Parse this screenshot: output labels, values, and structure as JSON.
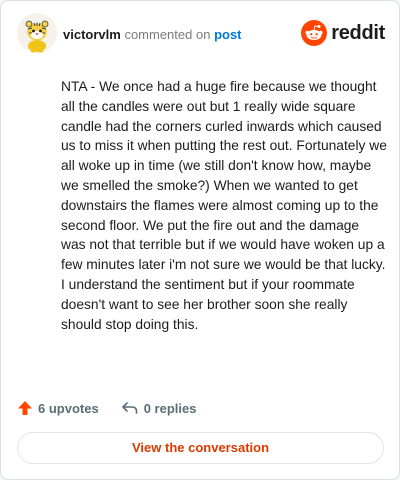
{
  "comment": {
    "author": "victorvlm",
    "action_text": "commented on",
    "post_link_label": "post",
    "body": "NTA - We once had a huge fire because we thought all the candles were out but 1 really wide square candle had the corners curled inwards which caused us to miss it when putting the rest out. Fortunately we all woke up in time (we still don't know how, maybe we smelled the smoke?) When we wanted to get downstairs the flames were almost coming up to the second floor. We put the fire out and the damage was not that terrible but if we would have woken up a few minutes later i'm not sure we would be that lucky. I understand the sentiment but if your roommate doesn't want to see her brother soon she really should stop doing this.",
    "avatar_icon": "snoo-avatar-icon"
  },
  "brand": {
    "name": "reddit",
    "icon": "reddit-logo-icon",
    "color": "#ff4500"
  },
  "actions": {
    "upvotes_label": "6 upvotes",
    "replies_label": "0 replies",
    "upvote_icon": "upvote-arrow-icon",
    "reply_icon": "reply-arrow-icon"
  },
  "cta": {
    "label": "View the conversation",
    "color": "#d93a00"
  }
}
